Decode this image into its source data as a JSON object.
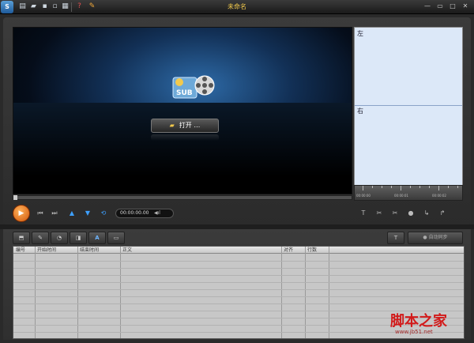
{
  "window": {
    "title": "未命名",
    "logo_text": "S",
    "controls": {
      "minimize": "—",
      "restore": "▭",
      "maximize": "□",
      "close": "✕"
    }
  },
  "quick_access": [
    {
      "name": "new-icon",
      "glyph": "▤"
    },
    {
      "name": "open-folder-icon",
      "glyph": "▰"
    },
    {
      "name": "save-icon",
      "glyph": "▪"
    },
    {
      "name": "save-as-icon",
      "glyph": "▫"
    },
    {
      "name": "print-icon",
      "glyph": "▦"
    },
    {
      "name": "help-icon",
      "glyph": "?"
    },
    {
      "name": "settings-wrench-icon",
      "glyph": "✎"
    }
  ],
  "player": {
    "open_button": {
      "label": "打开 …",
      "icon": "folder-icon"
    },
    "product_logo_text": "SUB",
    "side_panel": {
      "top_label": "左",
      "bottom_label": "右"
    },
    "ruler_labels": [
      "00:00:00",
      "00:00:01",
      "00:00:02"
    ],
    "timecode": "00:00:00.00",
    "volume_glyph": "◀ıl",
    "controls": {
      "play": "▶",
      "prev": "⏮",
      "next": "⏭",
      "up": "▲",
      "down": "▼",
      "loop": "⟲"
    },
    "right_tools": [
      "T",
      "✂",
      "✂",
      "●",
      "↳",
      "↱"
    ]
  },
  "toolbar": {
    "buttons": [
      "⬒",
      "✎",
      "◔",
      "◨",
      "A",
      "▭"
    ],
    "sync_label": "● 自动同步",
    "right_tool": "T"
  },
  "subtitle_table": {
    "columns": [
      "编号",
      "开始时间",
      "结束时间",
      "正文",
      "对齐",
      "行数"
    ],
    "empty_rows": 12
  },
  "watermark": {
    "text": "脚本之家",
    "url": "www.jb51.net"
  },
  "colors": {
    "title": "#f2c94c",
    "accent_orange": "#d0560a",
    "accent_blue": "#3ea0ff",
    "side_panel": "#dce8f8",
    "watermark": "#d21a1a"
  }
}
